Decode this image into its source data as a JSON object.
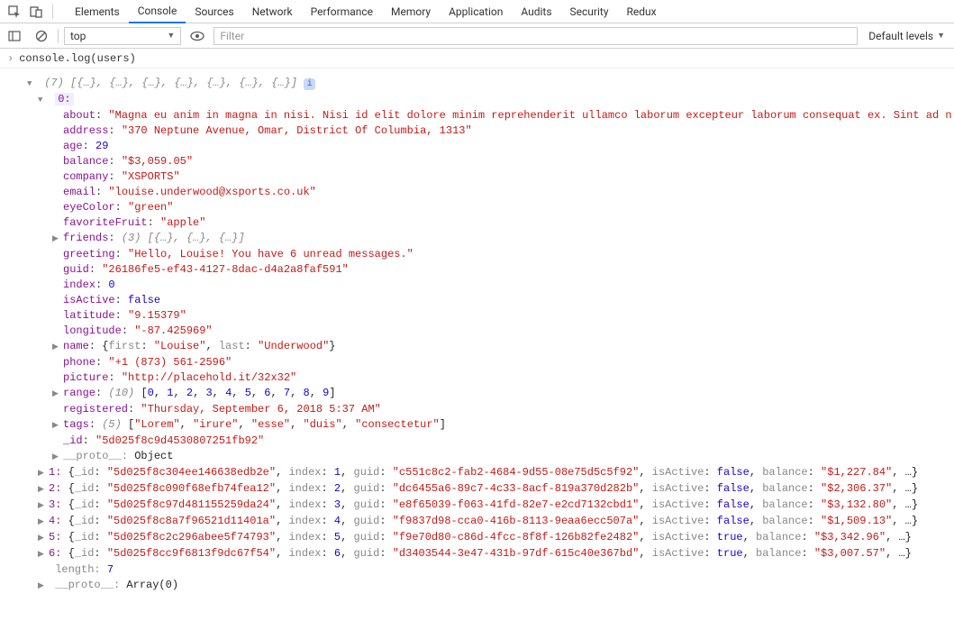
{
  "tabs": [
    "Elements",
    "Console",
    "Sources",
    "Network",
    "Performance",
    "Memory",
    "Application",
    "Audits",
    "Security",
    "Redux"
  ],
  "active_tab_index": 1,
  "context_selector": "top",
  "filter_placeholder": "Filter",
  "levels_label": "Default levels",
  "prompt_text": "console.log(users)",
  "array_header": "(7) [{…}, {…}, {…}, {…}, {…}, {…}, {…}]",
  "expanded_key": "0:",
  "entry0": {
    "about": "\"Magna eu anim in magna in nisi. Nisi id elit dolore minim reprehenderit ullamco laborum excepteur laborum consequat ex. Sint ad n",
    "address": "\"370 Neptune Avenue, Omar, District Of Columbia, 1313\"",
    "age": "29",
    "balance": "\"$3,059.05\"",
    "company": "\"XSPORTS\"",
    "email": "\"louise.underwood@xsports.co.uk\"",
    "eyeColor": "\"green\"",
    "favoriteFruit": "\"apple\"",
    "friends_summary": "(3) [{…}, {…}, {…}]",
    "greeting": "\"Hello, Louise! You have 6 unread messages.\"",
    "guid": "\"26186fe5-ef43-4127-8dac-d4a2a8faf591\"",
    "index": "0",
    "isActive": "false",
    "latitude": "\"9.15379\"",
    "longitude": "\"-87.425969\"",
    "name_first": "\"Louise\"",
    "name_last": "\"Underwood\"",
    "phone": "\"+1 (873) 561-2596\"",
    "picture": "\"http://placehold.it/32x32\"",
    "range_count": "(10)",
    "range_vals": [
      "0",
      "1",
      "2",
      "3",
      "4",
      "5",
      "6",
      "7",
      "8",
      "9"
    ],
    "registered": "\"Thursday, September 6, 2018 5:37 AM\"",
    "tags_count": "(5)",
    "tags_vals": [
      "\"Lorem\"",
      "\"irure\"",
      "\"esse\"",
      "\"duis\"",
      "\"consectetur\""
    ],
    "_id": "\"5d025f8c9d4530807251fb92\"",
    "proto": "Object"
  },
  "others": [
    {
      "k": "1",
      "_id": "\"5d025f8c304ee146638edb2e\"",
      "index": "1",
      "guid": "\"c551c8c2-fab2-4684-9d55-08e75d5c5f92\"",
      "isActive": "false",
      "balance": "\"$1,227.84\""
    },
    {
      "k": "2",
      "_id": "\"5d025f8c090f68efb74fea12\"",
      "index": "2",
      "guid": "\"dc6455a6-89c7-4c33-8acf-819a370d282b\"",
      "isActive": "false",
      "balance": "\"$2,306.37\""
    },
    {
      "k": "3",
      "_id": "\"5d025f8c97d481155259da24\"",
      "index": "3",
      "guid": "\"e8f65039-f063-41fd-82e7-e2cd7132cbd1\"",
      "isActive": "false",
      "balance": "\"$3,132.80\""
    },
    {
      "k": "4",
      "_id": "\"5d025f8c8a7f96521d11401a\"",
      "index": "4",
      "guid": "\"f9837d98-cca0-416b-8113-9eaa6ecc507a\"",
      "isActive": "false",
      "balance": "\"$1,509.13\""
    },
    {
      "k": "5",
      "_id": "\"5d025f8c2c296abee5f74793\"",
      "index": "5",
      "guid": "\"f9e70d80-c86d-4fcc-8f8f-126b82fe2482\"",
      "isActive": "true",
      "balance": "\"$3,342.96\""
    },
    {
      "k": "6",
      "_id": "\"5d025f8cc9f6813f9dc67f54\"",
      "index": "6",
      "guid": "\"d3403544-3e47-431b-97df-615c40e367bd\"",
      "isActive": "true",
      "balance": "\"$3,007.57\""
    }
  ],
  "length_val": "7",
  "proto_arr": "Array(0)",
  "labels": {
    "about": "about",
    "address": "address",
    "age": "age",
    "balance": "balance",
    "company": "company",
    "email": "email",
    "eyeColor": "eyeColor",
    "favoriteFruit": "favoriteFruit",
    "friends": "friends",
    "greeting": "greeting",
    "guid": "guid",
    "index": "index",
    "isActive": "isActive",
    "latitude": "latitude",
    "longitude": "longitude",
    "name": "name",
    "first": "first",
    "last": "last",
    "phone": "phone",
    "picture": "picture",
    "range": "range",
    "registered": "registered",
    "tags": "tags",
    "_id": "_id",
    "proto": "__proto__",
    "length": "length"
  }
}
